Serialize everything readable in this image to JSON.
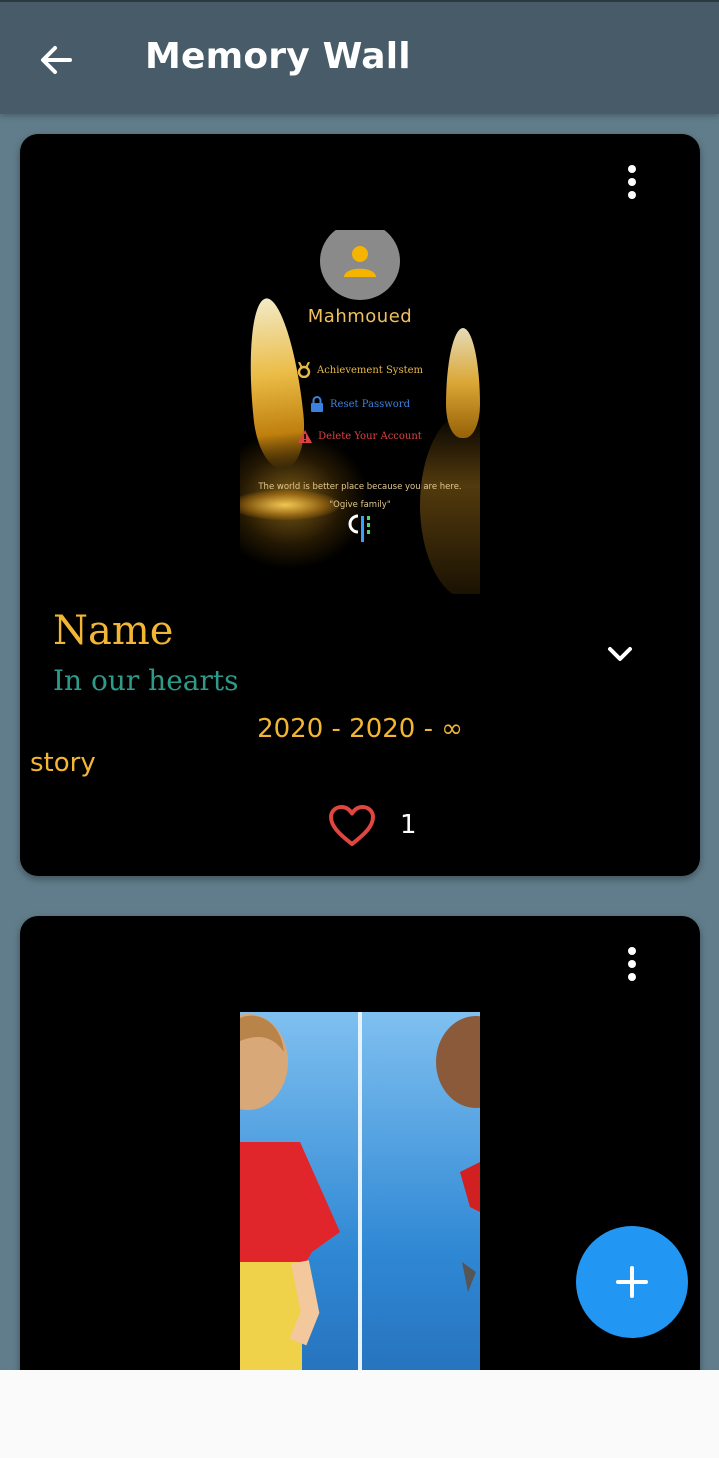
{
  "appbar": {
    "title": "Memory Wall"
  },
  "memories": [
    {
      "photo": {
        "profile_name": "Mahmoued",
        "menu": [
          {
            "label": "Achievement System",
            "icon": "medal-icon",
            "color": "#e8b94a"
          },
          {
            "label": "Reset Password",
            "icon": "lock-icon",
            "color": "#3b82e0"
          },
          {
            "label": "Delete Your Account",
            "icon": "warning-icon",
            "color": "#e04040"
          }
        ],
        "quote_line1": "The world is better place because you are here.",
        "quote_line2": "\"Ogive family\""
      },
      "name": "Name",
      "subtitle": "In our hearts",
      "dates": "2020 - 2020 - ∞",
      "story": "story",
      "likes": "1"
    },
    {
      "photo": {
        "description_icon": "child-photo"
      }
    }
  ],
  "colors": {
    "appbar": "#475c68",
    "background": "#617d8b",
    "accent_gold": "#f2b534",
    "teal": "#2d9a8a",
    "heart_red": "#e0463f",
    "fab_blue": "#2196f3"
  }
}
